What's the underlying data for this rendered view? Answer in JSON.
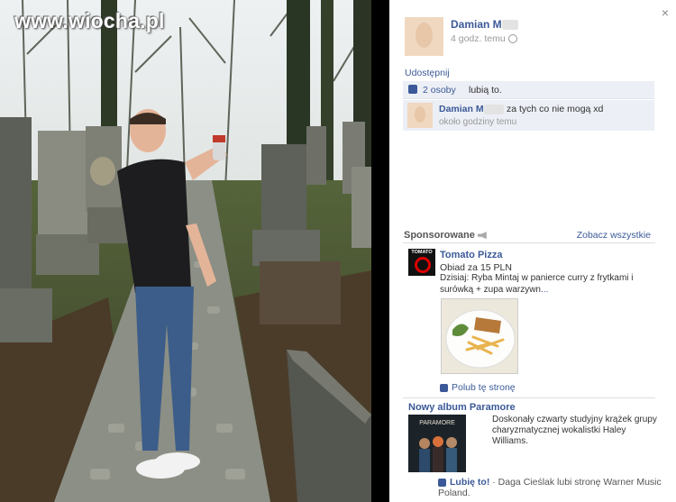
{
  "photo": {
    "watermark": "www.wiocha.pl"
  },
  "post": {
    "close_label": "×",
    "author_name": "Damian M",
    "time": "4 godz. temu",
    "share_label": "Udostępnij",
    "likes_link": "2 osoby",
    "likes_text": "lubią to.",
    "comment": {
      "author": "Damian M",
      "text": "za tych co nie mogą xd",
      "time": "około godziny temu"
    }
  },
  "sponsored": {
    "label": "Sponsorowane",
    "see_all": "Zobacz wszystkie",
    "ad1": {
      "logo_text": "TOMATO",
      "title": "Tomato Pizza",
      "subtitle": "Obiad za 15 PLN",
      "body": "Dzisiaj: Ryba Mintaj w panierce curry z frytkami i surówką + zupa warzywn",
      "more": "...",
      "like_page": "Polub tę stronę"
    },
    "ad2": {
      "title": "Nowy album Paramore",
      "album_text": "PARAMORE",
      "body": "Doskonały czwarty studyjny krążek grupy charyzmatycznej wokalistki Haley Williams.",
      "like_label": "Lubię to!",
      "like_sep": "·",
      "like_text": "Daga Cieślak lubi stronę Warner Music Poland."
    }
  },
  "colors": {
    "link": "#3b5998",
    "panel_bg": "#ffffff",
    "row_bg": "#eceff5"
  }
}
